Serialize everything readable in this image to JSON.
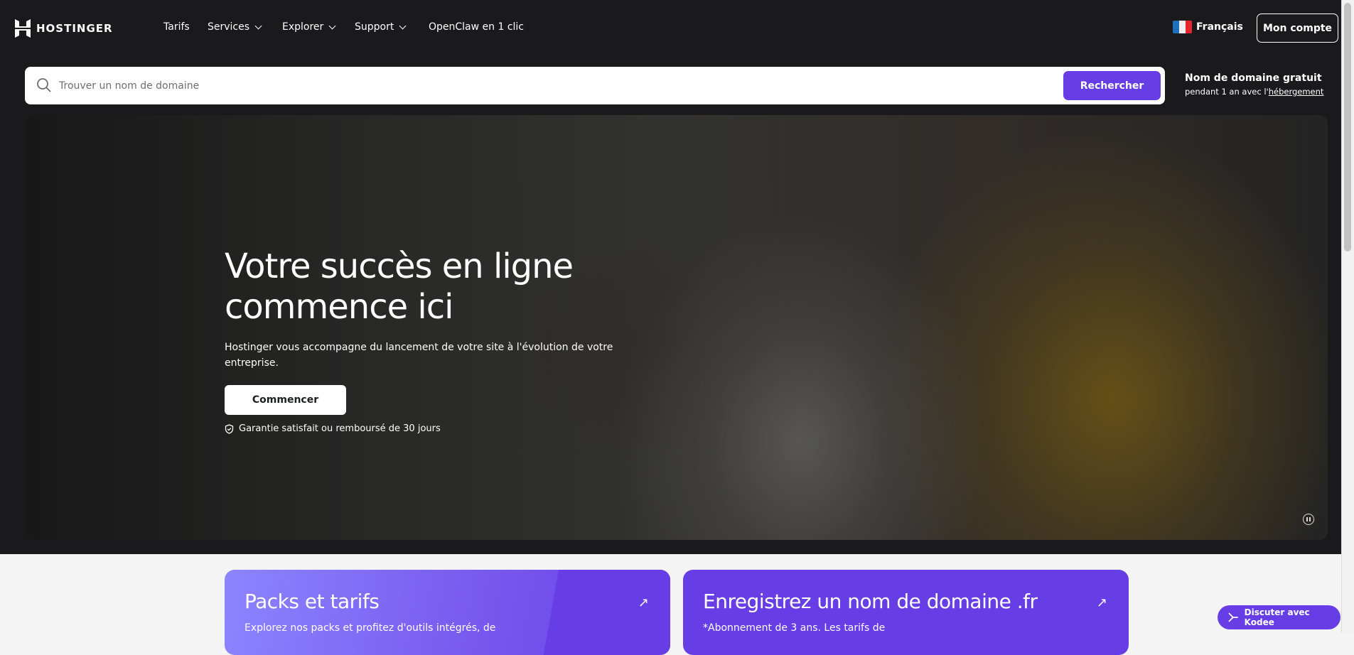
{
  "header": {
    "brand": "HOSTINGER",
    "nav": [
      {
        "label": "Tarifs",
        "dropdown": false
      },
      {
        "label": "Services",
        "dropdown": true
      },
      {
        "label": "Explorer",
        "dropdown": true
      },
      {
        "label": "Support",
        "dropdown": true
      },
      {
        "label": "OpenClaw en 1 clic",
        "dropdown": false
      }
    ],
    "language": "Français",
    "account_label": "Mon compte"
  },
  "search": {
    "placeholder": "Trouver un nom de domaine",
    "value": "",
    "button": "Rechercher"
  },
  "promo": {
    "title": "Nom de domaine gratuit",
    "text": "pendant 1 an avec l'",
    "link": "hébergement"
  },
  "hero": {
    "title_line1": "Votre succès en ligne",
    "title_line2": "commence ici",
    "description": "Hostinger vous accompagne du lancement de votre site à l'évolution de votre entreprise.",
    "cta": "Commencer",
    "guarantee": "Garantie satisfait ou remboursé de 30 jours"
  },
  "cards": [
    {
      "title": "Packs et tarifs",
      "text": "Explorez nos packs et profitez d'outils intégrés, de"
    },
    {
      "title": "Enregistrez un nom de domaine .fr",
      "text": "*Abonnement de 3 ans. Les tarifs de"
    }
  ],
  "chat": {
    "label": "Discuter avec Kodee"
  },
  "colors": {
    "brand": "#673de6",
    "dark": "#1a1a1d"
  }
}
